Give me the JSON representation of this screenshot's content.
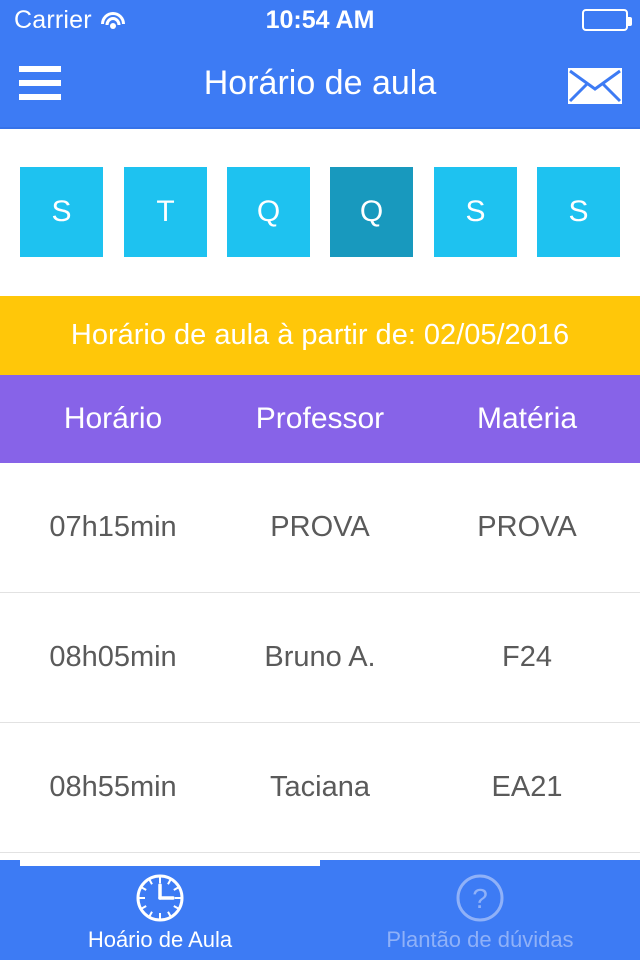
{
  "status_bar": {
    "carrier": "Carrier",
    "wifi_icon": "wifi-icon",
    "time": "10:54 AM",
    "battery_icon": "battery-icon"
  },
  "nav_bar": {
    "menu_icon": "hamburger-menu-icon",
    "title": "Horário de aula",
    "mail_icon": "envelope-icon",
    "background_color": "#3d7bf4"
  },
  "day_tabs": {
    "items": [
      {
        "label": "S",
        "selected": false
      },
      {
        "label": "T",
        "selected": false
      },
      {
        "label": "Q",
        "selected": false
      },
      {
        "label": "Q",
        "selected": true
      },
      {
        "label": "S",
        "selected": false
      },
      {
        "label": "S",
        "selected": false
      }
    ],
    "color": "#1ec2f0",
    "selected_color": "#1899be"
  },
  "banner": {
    "text": "Horário de aula à partir de: 02/05/2016",
    "background_color": "#ffc709"
  },
  "schedule_table": {
    "header_color": "#8763e8",
    "columns": [
      "Horário",
      "Professor",
      "Matéria"
    ],
    "rows": [
      {
        "horario": "07h15min",
        "professor": "PROVA",
        "materia": "PROVA"
      },
      {
        "horario": "08h05min",
        "professor": "Bruno A.",
        "materia": "F24"
      },
      {
        "horario": "08h55min",
        "professor": "Taciana",
        "materia": "EA21"
      }
    ]
  },
  "tab_bar": {
    "background_color": "#3d7bf4",
    "items": [
      {
        "label": "Hoário de Aula",
        "icon": "clock-icon",
        "active": true
      },
      {
        "label": "Plantão de dúvidas",
        "icon": "question-circle-icon",
        "active": false
      }
    ]
  }
}
